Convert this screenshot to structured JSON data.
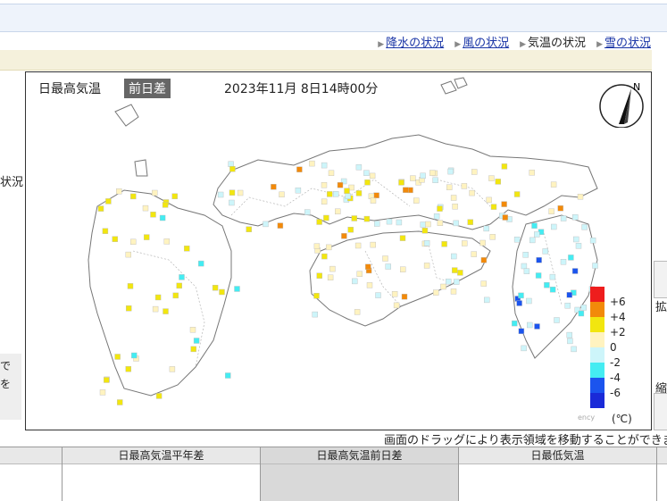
{
  "nav": {
    "links": [
      {
        "label": "降水の状況",
        "current": false
      },
      {
        "label": "風の状況",
        "current": false
      },
      {
        "label": "気温の状況",
        "current": true
      },
      {
        "label": "雪の状況",
        "current": false
      }
    ]
  },
  "side": {
    "left_label": "状況",
    "left_box_lines": [
      "で",
      "を"
    ],
    "right_labels": [
      "拡",
      "縮"
    ]
  },
  "map": {
    "title": "日最高気温",
    "tag": "前日差",
    "datetime": "2023年11月 8日14時00分",
    "compass": "N",
    "copyright": "ency",
    "unit": "(℃)",
    "legend": [
      {
        "label": "+6",
        "color": "#ee1d1d"
      },
      {
        "label": "+4",
        "color": "#f28a0a"
      },
      {
        "label": "+2",
        "color": "#f2e60f"
      },
      {
        "label": "0",
        "color": "#fff3c0"
      },
      {
        "label": "-2",
        "color": "#cdf5fa"
      },
      {
        "label": "-4",
        "color": "#44ecf2"
      },
      {
        "label": "-6",
        "color": "#1b54ee"
      },
      {
        "label": "",
        "color": "#1a2ad8"
      }
    ]
  },
  "drag_note": "画面のドラッグにより表示領域を移動することができま",
  "thumbnails": [
    {
      "label": "",
      "active": false
    },
    {
      "label": "日最高気温平年差",
      "active": false
    },
    {
      "label": "日最高気温前日差",
      "active": true
    },
    {
      "label": "日最低気温",
      "active": false
    },
    {
      "label": "",
      "active": false
    }
  ]
}
